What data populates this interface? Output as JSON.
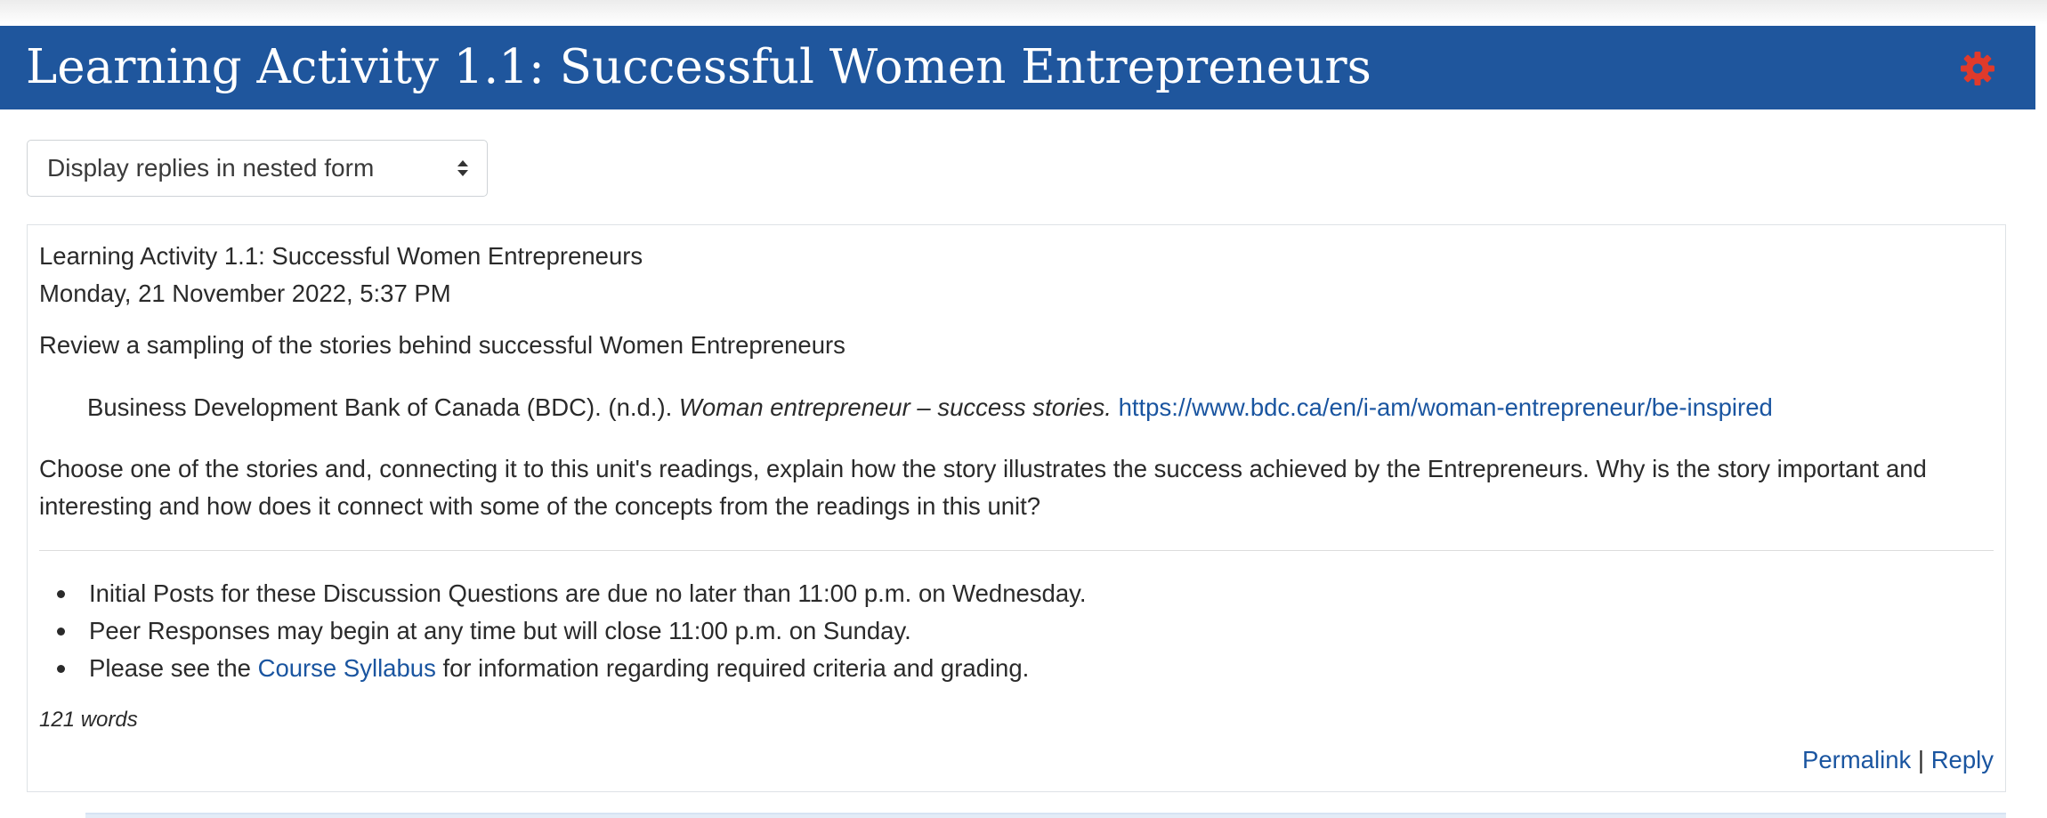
{
  "header": {
    "title": "Learning Activity 1.1: Successful Women Entrepreneurs",
    "gear_icon": "gear-icon",
    "bg_color": "#1f569d",
    "gear_color": "#e03a2b"
  },
  "display_mode": {
    "selected": "Display replies in nested form",
    "icon": "sort-arrows-icon"
  },
  "post": {
    "subject": "Learning Activity 1.1: Successful Women Entrepreneurs",
    "date": "Monday, 21 November 2022, 5:37 PM",
    "intro": "Review a sampling of the stories behind successful Women Entrepreneurs",
    "reference": {
      "author": "Business Development Bank of Canada (BDC). (n.d.).",
      "title": "Woman entrepreneur – success stories.",
      "url": "https://www.bdc.ca/en/i-am/woman-entrepreneur/be-inspired"
    },
    "question_line1": "Choose one of the stories and, connecting it to this unit's readings, explain how the story illustrates the success achieved by the Entrepreneurs. Why is the story important and",
    "question_line2": "interesting and how does it connect with some of the concepts from the readings in this unit?",
    "bullets": {
      "item1": "Initial Posts for these Discussion Questions are due no later than 11:00 p.m. on Wednesday.",
      "item2": "Peer Responses may begin at any time but will close 11:00 p.m. on Sunday.",
      "item3_before": "Please see the ",
      "item3_link": "Course Syllabus",
      "item3_after": " for information regarding required criteria and grading."
    },
    "word_count": "121 words",
    "actions": {
      "permalink": "Permalink",
      "separator": "|",
      "reply": "Reply"
    },
    "link_color": "#1a55a0"
  }
}
